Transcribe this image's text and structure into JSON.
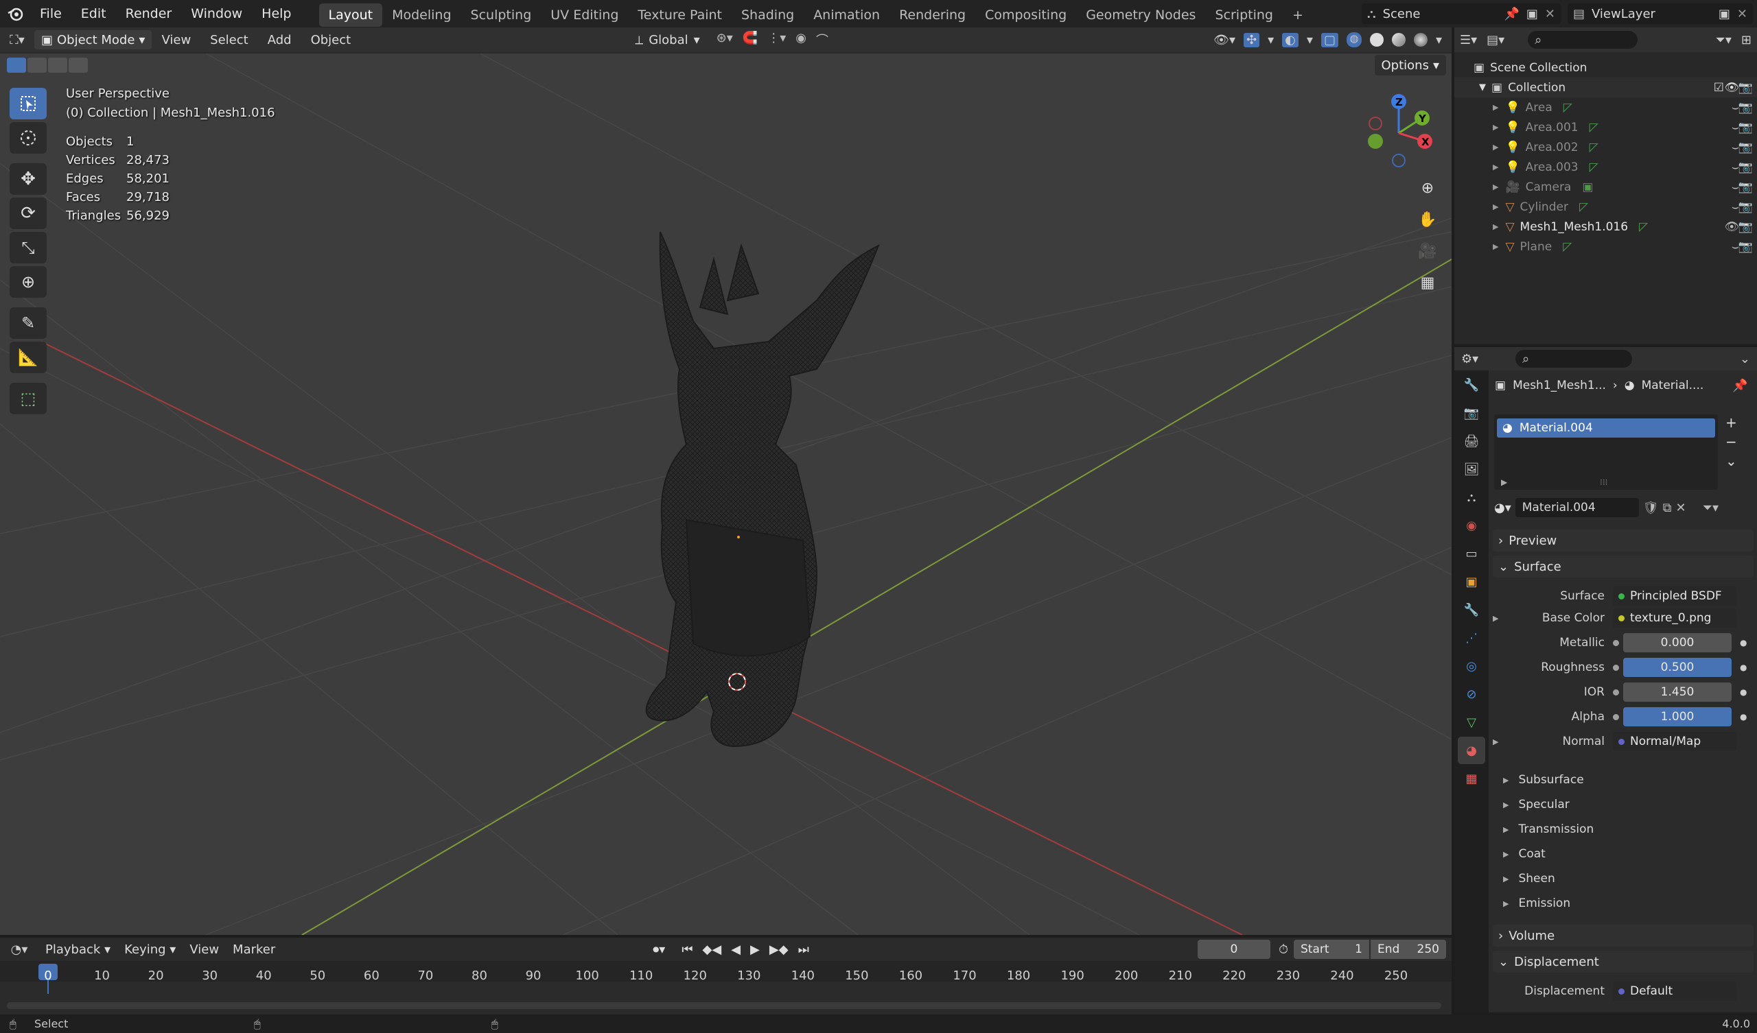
{
  "topbar": {
    "menus": [
      "File",
      "Edit",
      "Render",
      "Window",
      "Help"
    ],
    "workspaces": [
      "Layout",
      "Modeling",
      "Sculpting",
      "UV Editing",
      "Texture Paint",
      "Shading",
      "Animation",
      "Rendering",
      "Compositing",
      "Geometry Nodes",
      "Scripting"
    ],
    "active_workspace": "Layout",
    "add_tab": "+",
    "scene": "Scene",
    "view_layer": "ViewLayer"
  },
  "viewport_header": {
    "mode": "Object Mode",
    "menus": [
      "View",
      "Select",
      "Add",
      "Object"
    ],
    "transform": "Global",
    "options": "Options"
  },
  "viewport": {
    "view_name": "User Perspective",
    "collection_line": "(0) Collection | Mesh1_Mesh1.016",
    "stats": [
      {
        "label": "Objects",
        "value": "1"
      },
      {
        "label": "Vertices",
        "value": "28,473"
      },
      {
        "label": "Edges",
        "value": "58,201"
      },
      {
        "label": "Faces",
        "value": "29,718"
      },
      {
        "label": "Triangles",
        "value": "56,929"
      }
    ],
    "gizmo": {
      "z": "Z",
      "y": "Y",
      "x": "X"
    }
  },
  "outliner": {
    "scene_collection": "Scene Collection",
    "collection": "Collection",
    "items": [
      "Area",
      "Area.001",
      "Area.002",
      "Area.003",
      "Camera",
      "Cylinder",
      "Mesh1_Mesh1.016",
      "Plane"
    ]
  },
  "properties": {
    "breadcrumb_object": "Mesh1_Mesh1...",
    "breadcrumb_material": "Material....",
    "slot": "Material.004",
    "material_name": "Material.004",
    "preview": "Preview",
    "surface_panel": "Surface",
    "surface_label": "Surface",
    "surface_value": "Principled BSDF",
    "rows": [
      {
        "label": "Base Color",
        "value": "texture_0.png",
        "kind": "link",
        "dot": "#c7c729"
      },
      {
        "label": "Metallic",
        "value": "0.000",
        "kind": "grey",
        "dot": "#a0a0a0"
      },
      {
        "label": "Roughness",
        "value": "0.500",
        "kind": "blue",
        "dot": "#a0a0a0"
      },
      {
        "label": "IOR",
        "value": "1.450",
        "kind": "grey",
        "dot": "#a0a0a0"
      },
      {
        "label": "Alpha",
        "value": "1.000",
        "kind": "blue",
        "dot": "#a0a0a0"
      },
      {
        "label": "Normal",
        "value": "Normal/Map",
        "kind": "link",
        "dot": "#6363c7"
      }
    ],
    "subpanels": [
      "Subsurface",
      "Specular",
      "Transmission",
      "Coat",
      "Sheen",
      "Emission"
    ],
    "volume": "Volume",
    "displacement_panel": "Displacement",
    "displacement_label": "Displacement",
    "displacement_value": "Default"
  },
  "timeline": {
    "menus": [
      "Playback",
      "Keying",
      "View",
      "Marker"
    ],
    "current_frame": "0",
    "start_label": "Start",
    "start": "1",
    "end_label": "End",
    "end": "250",
    "ruler": [
      "0",
      "10",
      "20",
      "30",
      "40",
      "50",
      "60",
      "70",
      "80",
      "90",
      "100",
      "110",
      "120",
      "130",
      "140",
      "150",
      "160",
      "170",
      "180",
      "190",
      "200",
      "210",
      "220",
      "230",
      "240",
      "250"
    ]
  },
  "statusbar": {
    "left": "Select",
    "version": "4.0.0"
  }
}
